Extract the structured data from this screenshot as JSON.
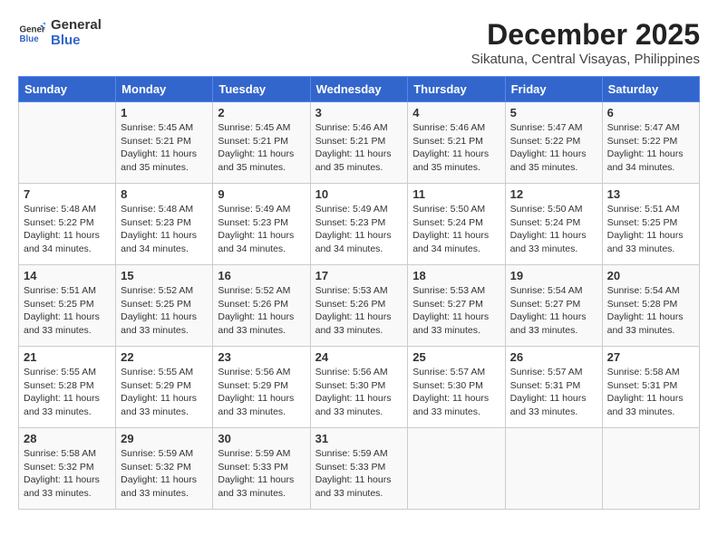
{
  "app": {
    "name": "GeneralBlue",
    "logo_text_1": "General",
    "logo_text_2": "Blue"
  },
  "calendar": {
    "month_year": "December 2025",
    "location": "Sikatuna, Central Visayas, Philippines",
    "days_of_week": [
      "Sunday",
      "Monday",
      "Tuesday",
      "Wednesday",
      "Thursday",
      "Friday",
      "Saturday"
    ],
    "weeks": [
      [
        {
          "day": "",
          "sunrise": "",
          "sunset": "",
          "daylight": ""
        },
        {
          "day": "1",
          "sunrise": "Sunrise: 5:45 AM",
          "sunset": "Sunset: 5:21 PM",
          "daylight": "Daylight: 11 hours and 35 minutes."
        },
        {
          "day": "2",
          "sunrise": "Sunrise: 5:45 AM",
          "sunset": "Sunset: 5:21 PM",
          "daylight": "Daylight: 11 hours and 35 minutes."
        },
        {
          "day": "3",
          "sunrise": "Sunrise: 5:46 AM",
          "sunset": "Sunset: 5:21 PM",
          "daylight": "Daylight: 11 hours and 35 minutes."
        },
        {
          "day": "4",
          "sunrise": "Sunrise: 5:46 AM",
          "sunset": "Sunset: 5:21 PM",
          "daylight": "Daylight: 11 hours and 35 minutes."
        },
        {
          "day": "5",
          "sunrise": "Sunrise: 5:47 AM",
          "sunset": "Sunset: 5:22 PM",
          "daylight": "Daylight: 11 hours and 35 minutes."
        },
        {
          "day": "6",
          "sunrise": "Sunrise: 5:47 AM",
          "sunset": "Sunset: 5:22 PM",
          "daylight": "Daylight: 11 hours and 34 minutes."
        }
      ],
      [
        {
          "day": "7",
          "sunrise": "Sunrise: 5:48 AM",
          "sunset": "Sunset: 5:22 PM",
          "daylight": "Daylight: 11 hours and 34 minutes."
        },
        {
          "day": "8",
          "sunrise": "Sunrise: 5:48 AM",
          "sunset": "Sunset: 5:23 PM",
          "daylight": "Daylight: 11 hours and 34 minutes."
        },
        {
          "day": "9",
          "sunrise": "Sunrise: 5:49 AM",
          "sunset": "Sunset: 5:23 PM",
          "daylight": "Daylight: 11 hours and 34 minutes."
        },
        {
          "day": "10",
          "sunrise": "Sunrise: 5:49 AM",
          "sunset": "Sunset: 5:23 PM",
          "daylight": "Daylight: 11 hours and 34 minutes."
        },
        {
          "day": "11",
          "sunrise": "Sunrise: 5:50 AM",
          "sunset": "Sunset: 5:24 PM",
          "daylight": "Daylight: 11 hours and 34 minutes."
        },
        {
          "day": "12",
          "sunrise": "Sunrise: 5:50 AM",
          "sunset": "Sunset: 5:24 PM",
          "daylight": "Daylight: 11 hours and 33 minutes."
        },
        {
          "day": "13",
          "sunrise": "Sunrise: 5:51 AM",
          "sunset": "Sunset: 5:25 PM",
          "daylight": "Daylight: 11 hours and 33 minutes."
        }
      ],
      [
        {
          "day": "14",
          "sunrise": "Sunrise: 5:51 AM",
          "sunset": "Sunset: 5:25 PM",
          "daylight": "Daylight: 11 hours and 33 minutes."
        },
        {
          "day": "15",
          "sunrise": "Sunrise: 5:52 AM",
          "sunset": "Sunset: 5:25 PM",
          "daylight": "Daylight: 11 hours and 33 minutes."
        },
        {
          "day": "16",
          "sunrise": "Sunrise: 5:52 AM",
          "sunset": "Sunset: 5:26 PM",
          "daylight": "Daylight: 11 hours and 33 minutes."
        },
        {
          "day": "17",
          "sunrise": "Sunrise: 5:53 AM",
          "sunset": "Sunset: 5:26 PM",
          "daylight": "Daylight: 11 hours and 33 minutes."
        },
        {
          "day": "18",
          "sunrise": "Sunrise: 5:53 AM",
          "sunset": "Sunset: 5:27 PM",
          "daylight": "Daylight: 11 hours and 33 minutes."
        },
        {
          "day": "19",
          "sunrise": "Sunrise: 5:54 AM",
          "sunset": "Sunset: 5:27 PM",
          "daylight": "Daylight: 11 hours and 33 minutes."
        },
        {
          "day": "20",
          "sunrise": "Sunrise: 5:54 AM",
          "sunset": "Sunset: 5:28 PM",
          "daylight": "Daylight: 11 hours and 33 minutes."
        }
      ],
      [
        {
          "day": "21",
          "sunrise": "Sunrise: 5:55 AM",
          "sunset": "Sunset: 5:28 PM",
          "daylight": "Daylight: 11 hours and 33 minutes."
        },
        {
          "day": "22",
          "sunrise": "Sunrise: 5:55 AM",
          "sunset": "Sunset: 5:29 PM",
          "daylight": "Daylight: 11 hours and 33 minutes."
        },
        {
          "day": "23",
          "sunrise": "Sunrise: 5:56 AM",
          "sunset": "Sunset: 5:29 PM",
          "daylight": "Daylight: 11 hours and 33 minutes."
        },
        {
          "day": "24",
          "sunrise": "Sunrise: 5:56 AM",
          "sunset": "Sunset: 5:30 PM",
          "daylight": "Daylight: 11 hours and 33 minutes."
        },
        {
          "day": "25",
          "sunrise": "Sunrise: 5:57 AM",
          "sunset": "Sunset: 5:30 PM",
          "daylight": "Daylight: 11 hours and 33 minutes."
        },
        {
          "day": "26",
          "sunrise": "Sunrise: 5:57 AM",
          "sunset": "Sunset: 5:31 PM",
          "daylight": "Daylight: 11 hours and 33 minutes."
        },
        {
          "day": "27",
          "sunrise": "Sunrise: 5:58 AM",
          "sunset": "Sunset: 5:31 PM",
          "daylight": "Daylight: 11 hours and 33 minutes."
        }
      ],
      [
        {
          "day": "28",
          "sunrise": "Sunrise: 5:58 AM",
          "sunset": "Sunset: 5:32 PM",
          "daylight": "Daylight: 11 hours and 33 minutes."
        },
        {
          "day": "29",
          "sunrise": "Sunrise: 5:59 AM",
          "sunset": "Sunset: 5:32 PM",
          "daylight": "Daylight: 11 hours and 33 minutes."
        },
        {
          "day": "30",
          "sunrise": "Sunrise: 5:59 AM",
          "sunset": "Sunset: 5:33 PM",
          "daylight": "Daylight: 11 hours and 33 minutes."
        },
        {
          "day": "31",
          "sunrise": "Sunrise: 5:59 AM",
          "sunset": "Sunset: 5:33 PM",
          "daylight": "Daylight: 11 hours and 33 minutes."
        },
        {
          "day": "",
          "sunrise": "",
          "sunset": "",
          "daylight": ""
        },
        {
          "day": "",
          "sunrise": "",
          "sunset": "",
          "daylight": ""
        },
        {
          "day": "",
          "sunrise": "",
          "sunset": "",
          "daylight": ""
        }
      ]
    ]
  }
}
